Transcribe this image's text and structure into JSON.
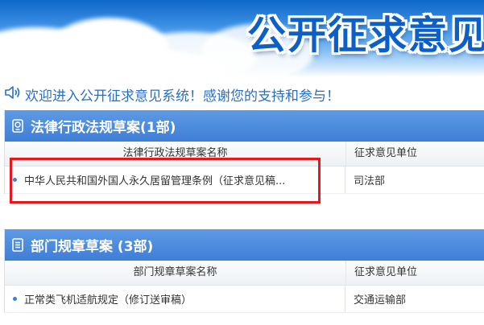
{
  "banner": {
    "title": "公开征求意见"
  },
  "welcome": {
    "text": "欢迎进入公开征求意见系统！感谢您的支持和参与！"
  },
  "sections": [
    {
      "title": "法律行政法规草案(1部)",
      "col_name": "法律行政法规草案名称",
      "col_unit": "征求意见单位",
      "rows": [
        {
          "name": "中华人民共和国外国人永久居留管理条例（征求意见稿...",
          "unit": "司法部"
        }
      ]
    },
    {
      "title": "部门规章草案 (3部)",
      "col_name": "部门规章草案名称",
      "col_unit": "征求意见单位",
      "rows": [
        {
          "name": "正常类飞机适航规定（修订送审稿）",
          "unit": "交通运输部"
        }
      ]
    }
  ],
  "colors": {
    "header_blue": "#3e7ed6",
    "title_blue": "#0b5fc6",
    "link_blue": "#2a70c2",
    "highlight_red": "#e8171b"
  }
}
